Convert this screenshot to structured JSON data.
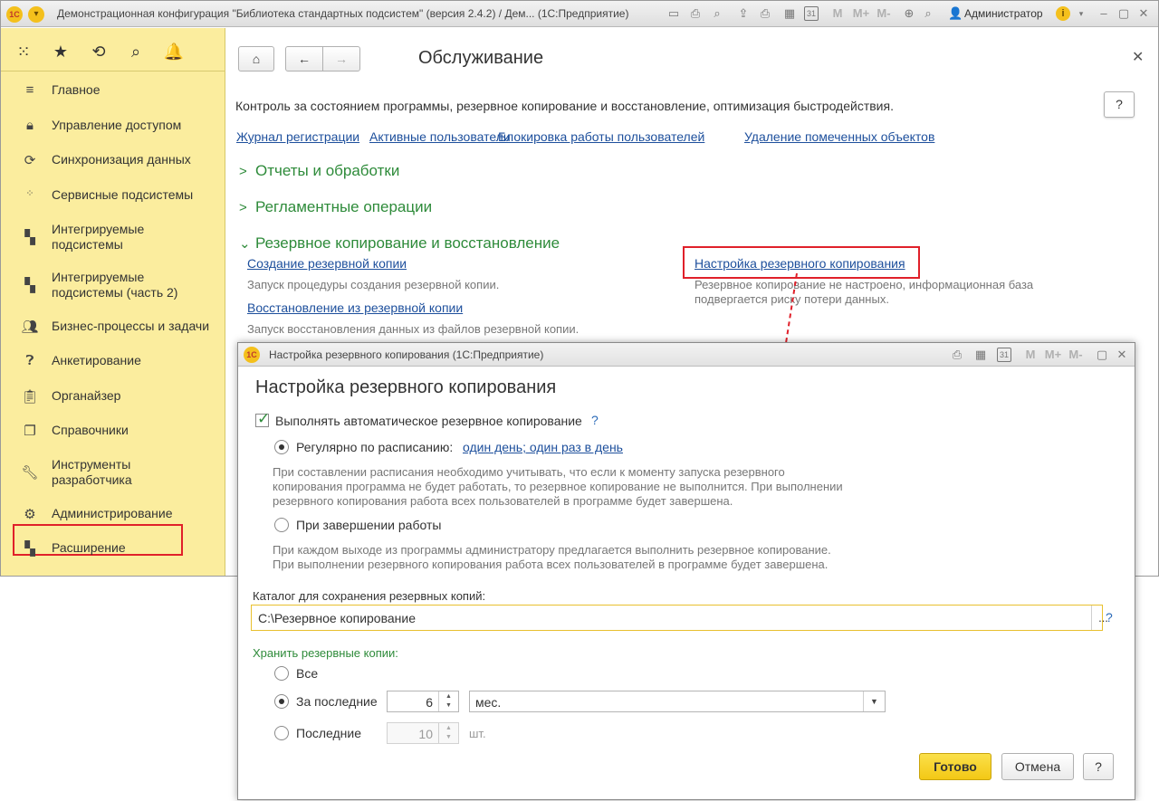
{
  "app": {
    "window_title": "Демонстрационная конфигурация \"Библиотека стандартных подсистем\" (версия 2.4.2) / Дем...  (1С:Предприятие)",
    "logo": "1С",
    "user": "Администратор",
    "toolbar_icons": [
      "save-icon",
      "print-icon",
      "preview-icon",
      "send-icon",
      "calculator-icon",
      "calendar-icon",
      "m-icon",
      "mplus-icon",
      "mminus-icon",
      "zoom-icon",
      "user-icon",
      "info-icon",
      "minimize-icon",
      "maximize-icon",
      "close-icon"
    ],
    "mem_labels": [
      "M",
      "M+",
      "M-"
    ]
  },
  "sidebar": {
    "items": [
      {
        "label": "Главное",
        "icon": "menu-lines-icon"
      },
      {
        "label": "Управление доступом",
        "icon": "lock-icon"
      },
      {
        "label": "Синхронизация данных",
        "icon": "sync-icon"
      },
      {
        "label": "Сервисные подсистемы",
        "icon": "grid-dots-icon"
      },
      {
        "label": "Интегрируемые подсистемы",
        "icon": "blocks-icon"
      },
      {
        "label": "Интегрируемые подсистемы (часть 2)",
        "icon": "blocks-icon"
      },
      {
        "label": "Бизнес-процессы и задачи",
        "icon": "people-icon"
      },
      {
        "label": "Анкетирование",
        "icon": "question-circle-icon"
      },
      {
        "label": "Органайзер",
        "icon": "clipboard-icon"
      },
      {
        "label": "Справочники",
        "icon": "books-icon"
      },
      {
        "label": "Инструменты разработчика",
        "icon": "wrench-icon"
      },
      {
        "label": "Администрирование",
        "icon": "gear-icon"
      },
      {
        "label": "Расширение",
        "icon": "blocks-icon"
      }
    ]
  },
  "content": {
    "title": "Обслуживание",
    "description": "Контроль за состоянием программы, резервное копирование и восстановление, оптимизация быстродействия.",
    "help": "?",
    "top_links": [
      "Журнал регистрации",
      "Активные пользователи",
      "Блокировка работы пользователей",
      "Удаление помеченных объектов"
    ],
    "groups": [
      {
        "title": "Отчеты и обработки",
        "expanded": false
      },
      {
        "title": "Регламентные операции",
        "expanded": false
      },
      {
        "title": "Резервное копирование и восстановление",
        "expanded": true
      }
    ],
    "backup": {
      "create_link": "Создание резервной копии",
      "create_desc": "Запуск процедуры создания резервной копии.",
      "restore_link": "Восстановление из резервной копии",
      "restore_desc": "Запуск восстановления данных из файлов резервной копии.",
      "settings_link": "Настройка резервного копирования",
      "settings_desc_1": "Резервное копирование не настроено, информационная база",
      "settings_desc_2": "подвергается риску потери данных."
    }
  },
  "dialog": {
    "window_title": "Настройка резервного копирования  (1С:Предприятие)",
    "heading": "Настройка резервного копирования",
    "auto_backup_label": "Выполнять автоматическое резервное копирование",
    "auto_backup_checked": true,
    "help": "?",
    "schedule_label": "Регулярно по расписанию:",
    "schedule_link": "один день; один раз в день",
    "schedule_hint_1": "При составлении расписания необходимо учитывать, что если к моменту запуска резервного",
    "schedule_hint_2": "копирования программа не будет работать, то резервное копирование не выполнится. При выполнении",
    "schedule_hint_3": "резервного копирования работа всех пользователей в программе будет завершена.",
    "on_exit_label": "При завершении работы",
    "on_exit_hint_1": "При каждом выходе из программы администратору предлагается выполнить резервное копирование.",
    "on_exit_hint_2": "При выполнении резервного копирования работа всех пользователей в программе будет завершена.",
    "catalog_label": "Каталог для сохранения резервных копий:",
    "catalog_value": "C:\\Резервное копирование",
    "catalog_button": "...",
    "keep_label": "Хранить резервные копии:",
    "keep_all": "Все",
    "keep_last_period": "За последние",
    "keep_last_period_value": "6",
    "keep_period_unit": "мес.",
    "keep_last_count": "Последние",
    "keep_last_count_value": "10",
    "keep_count_unit": "шт.",
    "btn_done": "Готово",
    "btn_cancel": "Отмена",
    "btn_help": "?"
  },
  "colors": {
    "accent_red": "#e0202a",
    "group_green": "#2e8b3a",
    "link_blue": "#1d4f9c",
    "sidebar_yellow": "#fbed9e",
    "primary_button": "#f3c815"
  }
}
